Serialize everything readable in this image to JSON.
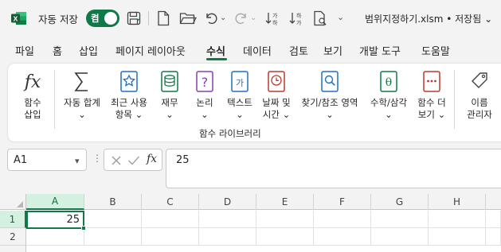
{
  "titlebar": {
    "app_icon": "excel-logo",
    "autosave_label": "자동 저장",
    "autosave_state": "켬",
    "document_title": "범위지정하기.xlsm • 저장됨 ⌄",
    "icons": [
      "save-icon",
      "new-file-icon",
      "open-folder-icon",
      "undo-icon",
      "redo-icon",
      "sort-ascending-icon",
      "sort-descending-icon",
      "print-preview-icon",
      "customize-toolbar-icon"
    ]
  },
  "menu": {
    "tabs": [
      "파일",
      "홈",
      "삽입",
      "페이지 레이아웃",
      "수식",
      "데이터",
      "검토",
      "보기",
      "개발 도구",
      "도움말"
    ],
    "active": "수식"
  },
  "ribbon": {
    "group_label": "함수 라이브러리",
    "buttons": [
      {
        "label1": "함수",
        "label2": "삽입",
        "icon": "fx-icon"
      },
      {
        "label1": "자동 합계",
        "label2": "⌄",
        "icon": "sigma-icon"
      },
      {
        "label1": "최근 사용",
        "label2": "항목 ⌄",
        "icon": "star-book-icon"
      },
      {
        "label1": "재무",
        "label2": "⌄",
        "icon": "finance-book-icon"
      },
      {
        "label1": "논리",
        "label2": "⌄",
        "icon": "logic-book-icon"
      },
      {
        "label1": "텍스트",
        "label2": "⌄",
        "icon": "text-book-icon"
      },
      {
        "label1": "날짜 및",
        "label2": "시간 ⌄",
        "icon": "clock-book-icon"
      },
      {
        "label1": "찾기/참조 영역",
        "label2": "⌄",
        "icon": "lookup-book-icon"
      },
      {
        "label1": "수학/삼각",
        "label2": "⌄",
        "icon": "math-book-icon"
      },
      {
        "label1": "함수 더",
        "label2": "보기 ⌄",
        "icon": "more-functions-icon"
      },
      {
        "label1": "이름",
        "label2": "관리자",
        "icon": "name-manager-icon"
      }
    ]
  },
  "formula_bar": {
    "name_box": "A1",
    "formula": "25",
    "fx_label": "fx"
  },
  "grid": {
    "columns": [
      "A",
      "B",
      "C",
      "D",
      "E",
      "F",
      "G",
      "H"
    ],
    "rows": [
      "1",
      "2"
    ],
    "selected_cell": "A1",
    "cells": {
      "A1": "25"
    }
  },
  "colors": {
    "accent": "#117847",
    "selection_fill": "#d3f0e0"
  }
}
